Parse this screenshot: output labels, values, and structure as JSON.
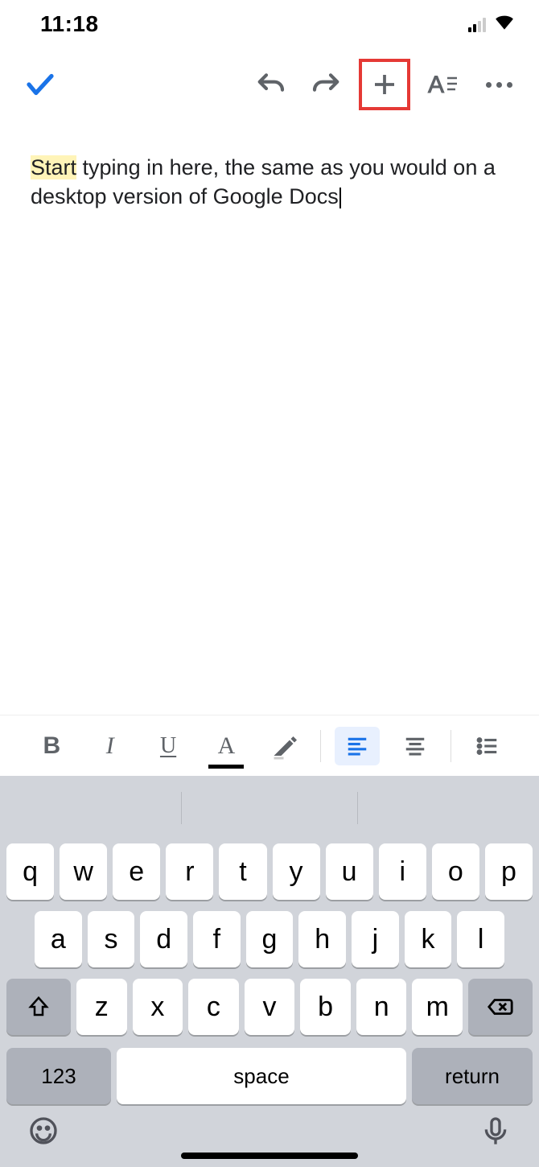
{
  "status": {
    "time": "11:18"
  },
  "doc": {
    "highlighted": "Start",
    "rest": " typing in here, the same as you would on a desktop version of Google Docs"
  },
  "keyboard": {
    "row1": [
      "q",
      "w",
      "e",
      "r",
      "t",
      "y",
      "u",
      "i",
      "o",
      "p"
    ],
    "row2": [
      "a",
      "s",
      "d",
      "f",
      "g",
      "h",
      "j",
      "k",
      "l"
    ],
    "row3": [
      "z",
      "x",
      "c",
      "v",
      "b",
      "n",
      "m"
    ],
    "num": "123",
    "space": "space",
    "return": "return"
  }
}
